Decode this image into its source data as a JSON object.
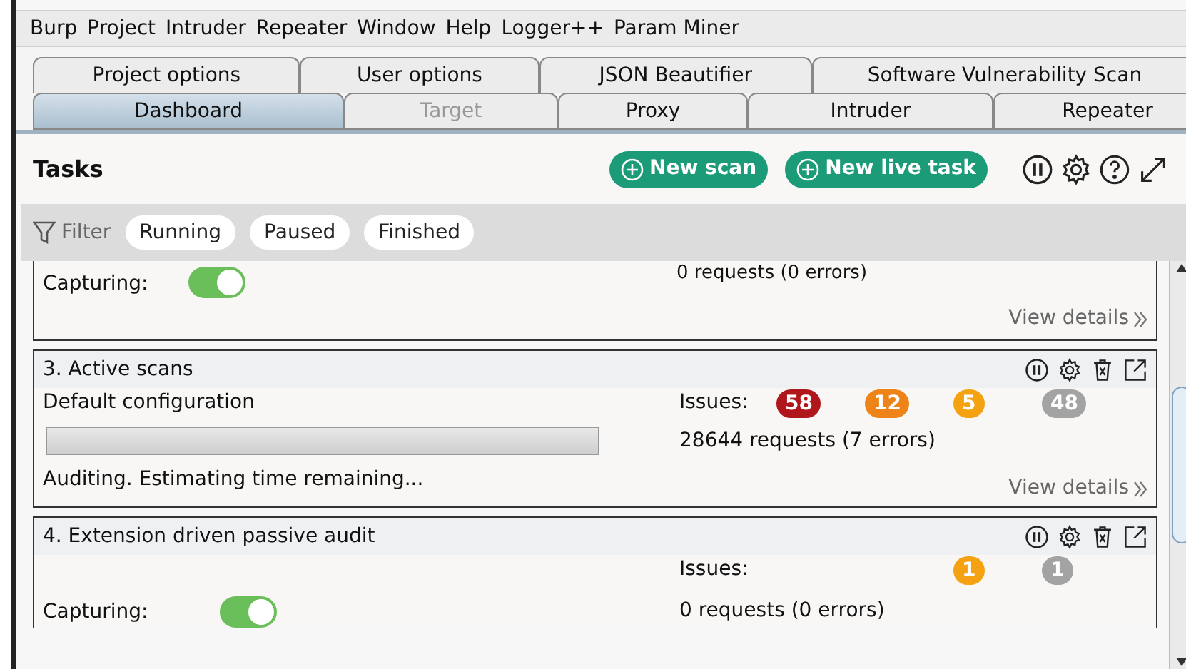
{
  "menu": [
    "Burp",
    "Project",
    "Intruder",
    "Repeater",
    "Window",
    "Help",
    "Logger++",
    "Param Miner"
  ],
  "tabs_top": [
    {
      "label": "Project options",
      "selected": false
    },
    {
      "label": "User options",
      "selected": false
    },
    {
      "label": "JSON Beautifier",
      "selected": false
    },
    {
      "label": "Software Vulnerability Scan",
      "selected": false
    }
  ],
  "tabs_bottom": [
    {
      "label": "Dashboard",
      "selected": true,
      "disabled": false
    },
    {
      "label": "Target",
      "selected": false,
      "disabled": true
    },
    {
      "label": "Proxy",
      "selected": false,
      "disabled": false
    },
    {
      "label": "Intruder",
      "selected": false,
      "disabled": false
    },
    {
      "label": "Repeater",
      "selected": false,
      "disabled": false
    }
  ],
  "tasks": {
    "title": "Tasks",
    "buttons": [
      "New scan",
      "New live task"
    ]
  },
  "filter": {
    "label": "Filter",
    "chips": [
      "Running",
      "Paused",
      "Finished"
    ]
  },
  "cards": [
    {
      "kind": "partial_top",
      "capturing_label": "Capturing:",
      "capturing_on": true,
      "requests": "0 requests (0 errors)",
      "view_details": "View details"
    },
    {
      "kind": "scan",
      "title": "3. Active scans",
      "config": "Default configuration",
      "issues_label": "Issues:",
      "issues": [
        {
          "kind": "high",
          "color": "#b0171c",
          "count": "58"
        },
        {
          "kind": "medium",
          "color": "#ee8418",
          "count": "12"
        },
        {
          "kind": "low",
          "color": "#f4a211",
          "count": "5"
        },
        {
          "kind": "info",
          "color": "#a3a3a3",
          "count": "48"
        }
      ],
      "level": 0,
      "requests": "28644 requests (7 errors)",
      "status": "Auditing. Estimating time remaining...",
      "view_details": "View details"
    },
    {
      "kind": "partial_bottom",
      "title": "4. Extension driven passive audit",
      "issues_label": "Issues:",
      "issues": [
        {
          "kind": "low",
          "color": "#f4a211",
          "count": "1"
        },
        {
          "kind": "info",
          "color": "#a3a3a3",
          "count": "1"
        }
      ],
      "capturing_label": "Capturing:",
      "capturing_on": true,
      "requests": "0 requests (0 errors)"
    }
  ]
}
